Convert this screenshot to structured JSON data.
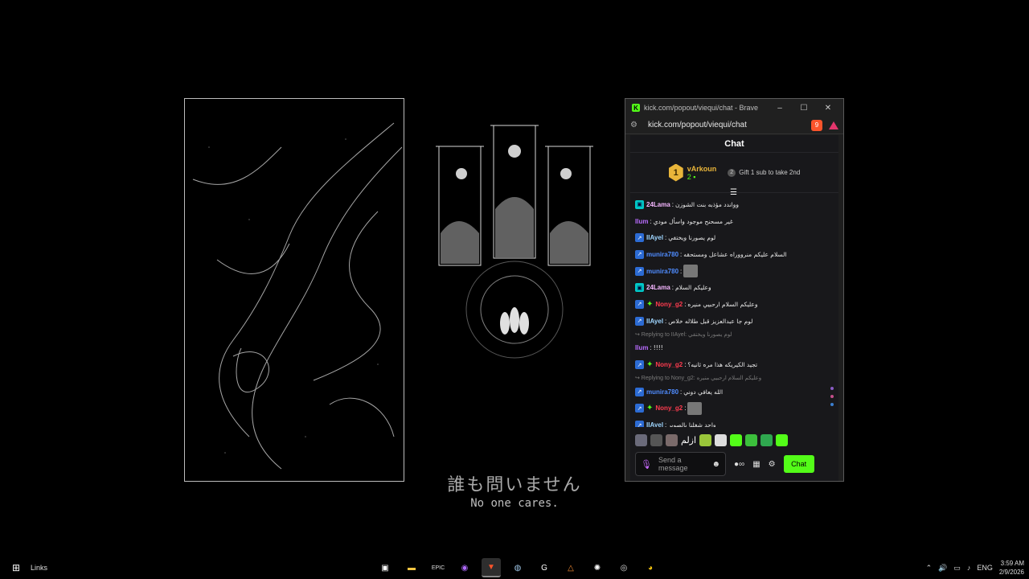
{
  "wallpaper": {
    "caption_jp": "誰も問いません",
    "caption_en": "No one cares."
  },
  "browser": {
    "window_title": "kick.com/popout/viequi/chat - Brave",
    "url": "kick.com/popout/viequi/chat",
    "brave_badge_count": "9",
    "window_controls": {
      "minimize": "–",
      "maximize": "☐",
      "close": "✕"
    }
  },
  "chat": {
    "header": "Chat",
    "top_sub": {
      "rank": "1",
      "username": "vArkoun",
      "count": "2",
      "gift_text": "Gift 1 sub to take 2nd"
    },
    "messages": [
      {
        "type": "msg",
        "badges": [
          "og"
        ],
        "user": "24Lama",
        "color": "#f5b6ff",
        "text": "وواندد مؤذبه بنت الشوزن"
      },
      {
        "type": "msg",
        "badges": [],
        "user": "Ilum",
        "color": "#b86bff",
        "text": "غير مسحنح موجود واسأل مودي"
      },
      {
        "type": "msg",
        "badges": [
          "vip"
        ],
        "user": "IIAyel",
        "color": "#9fd6ff",
        "text": "لوم يصورنا ويختفي"
      },
      {
        "type": "msg",
        "badges": [
          "vip"
        ],
        "user": "munira780",
        "color": "#4f8cff",
        "text": "السلام عليكم منرووراه عشاعل ومستحقه"
      },
      {
        "type": "msg",
        "badges": [
          "vip"
        ],
        "user": "munira780",
        "color": "#4f8cff",
        "text": "",
        "emote": true
      },
      {
        "type": "msg",
        "badges": [
          "og"
        ],
        "user": "24Lama",
        "color": "#f5b6ff",
        "text": "وعليكم السلام"
      },
      {
        "type": "msg",
        "badges": [
          "vip",
          "sparkle"
        ],
        "user": "Nony_g2",
        "color": "#ff3b4f",
        "text": "وعليكم السلام ارحبيي منيره"
      },
      {
        "type": "msg",
        "badges": [
          "vip"
        ],
        "user": "IIAyel",
        "color": "#9fd6ff",
        "text": "لوم جا عبدالعزيز قبل طلاله خلاص"
      },
      {
        "type": "reply",
        "text": "Replying to IIAyel: لوم يصورنا ويختفي"
      },
      {
        "type": "msg",
        "badges": [],
        "user": "Ilum",
        "color": "#b86bff",
        "text": "!!!!"
      },
      {
        "type": "msg",
        "badges": [
          "vip",
          "sparkle"
        ],
        "user": "Nony_g2",
        "color": "#ff3b4f",
        "text": "تجيد الكيريكه هذا مره ثانيه؟"
      },
      {
        "type": "reply",
        "text": "Replying to Nony_g2: وعليكم السلام ارحبيي منيره"
      },
      {
        "type": "msg",
        "badges": [
          "vip"
        ],
        "user": "munira780",
        "color": "#4f8cff",
        "text": "الله يعافي دوني"
      },
      {
        "type": "msg",
        "badges": [
          "vip",
          "sparkle"
        ],
        "user": "Nony_g2",
        "color": "#ff3b4f",
        "text": "",
        "emote": true
      },
      {
        "type": "msg",
        "badges": [
          "vip"
        ],
        "user": "IIAyel",
        "color": "#9fd6ff",
        "text": "واحد شغلنا بالصوير"
      }
    ],
    "emote_text": "ازلم",
    "input_placeholder": "Send a message",
    "kicks_label": "∞",
    "send_label": "Chat",
    "accent": "#53fc18"
  },
  "taskbar": {
    "links_label": "Links",
    "apps": [
      "store-icon",
      "file-explorer-icon",
      "epic-games-icon",
      "messenger-icon",
      "brave-icon",
      "steam-icon",
      "g-hub-icon",
      "affinity-icon",
      "steelseries-icon",
      "obs-icon",
      "chrome-icon"
    ],
    "epic_label": "EPIC",
    "language": "ENG",
    "time": "3:59 AM",
    "date": "2/9/2026"
  }
}
